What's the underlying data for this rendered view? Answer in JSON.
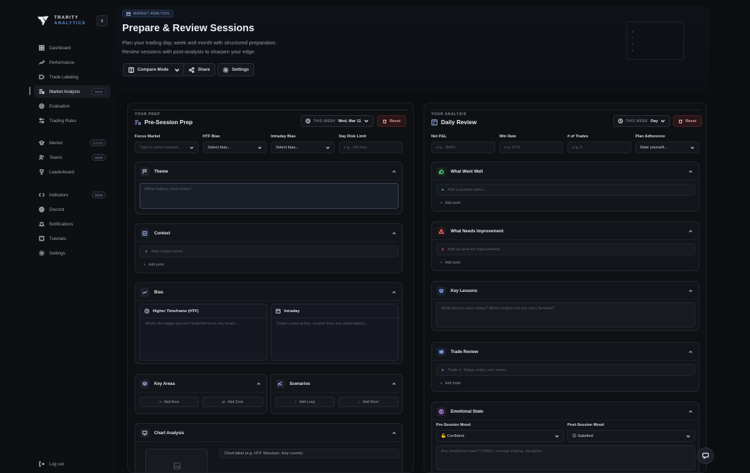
{
  "brand": {
    "line1": "TRARITY",
    "line2": "ANALYTICS"
  },
  "nav": {
    "dashboard": "Dashboard",
    "performance": "Performance",
    "trade_labeling": "Trade Labeling",
    "market_analysis": "Market Analysis",
    "market_analysis_badge": "NEW",
    "evaluation": "Evaluation",
    "trading_rules": "Trading Rules",
    "mentor": "Mentor",
    "mentor_badge": "SOON",
    "teams": "Teams",
    "teams_badge": "NEW",
    "leaderboard": "Leaderboard",
    "indicators": "Indicators",
    "indicators_badge": "NEW",
    "discord": "Discord",
    "notifications": "Notifications",
    "tutorials": "Tutorials",
    "settings": "Settings",
    "logout": "Log out"
  },
  "header": {
    "breadcrumb": "MARKET ANALYSIS",
    "title": "Prepare & Review Sessions",
    "subtitle1": "Plan your trading day, week and month with structured preparation.",
    "subtitle2": "Review sessions with post-analysis to sharpen your edge.",
    "compare_mode": "Compare Mode",
    "share": "Share",
    "settings": "Settings"
  },
  "prep": {
    "tag": "YOUR PREP",
    "title": "Pre-Session Prep",
    "week_label": "THIS WEEK",
    "week_value": "Wed, Mar 11",
    "reset": "Reset",
    "focus_market_label": "Focus Market",
    "focus_market_ph": "Type or select market...",
    "htf_bias_label": "HTF Bias",
    "htf_bias_value": "Select bias...",
    "intraday_bias_label": "Intraday Bias",
    "intraday_bias_value": "Select bias...",
    "risk_label": "Day Risk Limit",
    "risk_ph": "e.g. -2R max",
    "theme_title": "Theme",
    "theme_ph": "What matters most today?",
    "context_title": "Context",
    "context_ph": "Add context point...",
    "add_point": "Add point",
    "bias_title": "Bias",
    "htf_title": "Higher Timeframe (HTF)",
    "htf_ph": "What's the bigger picture? Daily/4H trend, key levels...",
    "intraday_title": "Intraday",
    "intraday_ph": "Today's price action, session flow, key observations...",
    "key_areas_title": "Key Areas",
    "add_area": "Add Area",
    "add_zone": "Add Zone",
    "scenarios_title": "Scenarios",
    "add_long": "Add Long",
    "add_short": "Add Short",
    "chart_title": "Chart Analysis",
    "chart_label_ph": "Chart label (e.g. HTF Structure, Key Levels)"
  },
  "review": {
    "tag": "YOUR ANALYSIS",
    "title": "Daily Review",
    "week_label": "THIS WEEK",
    "week_value": "Day",
    "reset": "Reset",
    "pnl_label": "Net P&L",
    "pnl_ph": "e.g. +$450",
    "winrate_label": "Win Rate",
    "winrate_ph": "e.g. 67%",
    "trades_label": "# of Trades",
    "trades_ph": "e.g. 5",
    "adherence_label": "Plan Adherence",
    "adherence_value": "Rate yourself...",
    "went_well_title": "What Went Well",
    "went_well_ph": "Add a positive point...",
    "add_point": "Add point",
    "improve_title": "What Needs Improvement",
    "improve_ph": "Add an area for improvement...",
    "lessons_title": "Key Lessons",
    "lessons_ph": "What did you learn today? What insights will you carry forward?",
    "trade_review_title": "Trade Review",
    "trade_ph": "Trade 1: Setup, entry, exit, notes...",
    "add_trade": "Add trade",
    "emotional_title": "Emotional State",
    "pre_mood_label": "Pre-Session Mood",
    "pre_mood_value": "💪 Confident",
    "post_mood_label": "Post-Session Mood",
    "post_mood_value": "😊 Satisfied",
    "emotional_ph": "Any emotional notes? FOMO, revenge trading, discipline..."
  },
  "colors": {
    "accent": "#6f8fd8",
    "danger": "#e59a9f",
    "success": "#4fbf7a"
  }
}
